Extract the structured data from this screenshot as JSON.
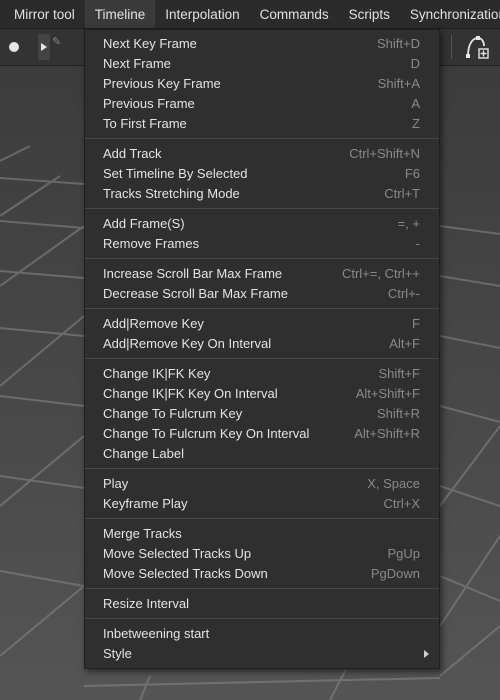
{
  "menubar": {
    "items": [
      {
        "label": "Mirror tool"
      },
      {
        "label": "Timeline"
      },
      {
        "label": "Interpolation"
      },
      {
        "label": "Commands"
      },
      {
        "label": "Scripts"
      },
      {
        "label": "Synchronization"
      }
    ],
    "active_index": 1
  },
  "menu": {
    "groups": [
      [
        {
          "label": "Next Key Frame",
          "shortcut": "Shift+D"
        },
        {
          "label": "Next Frame",
          "shortcut": "D"
        },
        {
          "label": "Previous Key Frame",
          "shortcut": "Shift+A"
        },
        {
          "label": "Previous Frame",
          "shortcut": "A"
        },
        {
          "label": "To First Frame",
          "shortcut": "Z"
        }
      ],
      [
        {
          "label": "Add Track",
          "shortcut": "Ctrl+Shift+N"
        },
        {
          "label": "Set Timeline By Selected",
          "shortcut": "F6"
        },
        {
          "label": "Tracks Stretching Mode",
          "shortcut": "Ctrl+T"
        }
      ],
      [
        {
          "label": "Add Frame(S)",
          "shortcut": "=, +"
        },
        {
          "label": "Remove Frames",
          "shortcut": "-"
        }
      ],
      [
        {
          "label": "Increase Scroll Bar Max Frame",
          "shortcut": "Ctrl+=, Ctrl++"
        },
        {
          "label": "Decrease Scroll Bar Max Frame",
          "shortcut": "Ctrl+-"
        }
      ],
      [
        {
          "label": "Add|Remove Key",
          "shortcut": "F"
        },
        {
          "label": "Add|Remove Key On Interval",
          "shortcut": "Alt+F"
        }
      ],
      [
        {
          "label": "Change IK|FK Key",
          "shortcut": "Shift+F"
        },
        {
          "label": "Change IK|FK Key On Interval",
          "shortcut": "Alt+Shift+F"
        },
        {
          "label": "Change To Fulcrum Key",
          "shortcut": "Shift+R"
        },
        {
          "label": "Change To Fulcrum Key On Interval",
          "shortcut": "Alt+Shift+R"
        },
        {
          "label": "Change Label",
          "shortcut": ""
        }
      ],
      [
        {
          "label": "Play",
          "shortcut": "X, Space"
        },
        {
          "label": "Keyframe Play",
          "shortcut": "Ctrl+X"
        }
      ],
      [
        {
          "label": "Merge Tracks",
          "shortcut": ""
        },
        {
          "label": "Move Selected Tracks Up",
          "shortcut": "PgUp"
        },
        {
          "label": "Move Selected Tracks Down",
          "shortcut": "PgDown"
        }
      ],
      [
        {
          "label": "Resize Interval",
          "shortcut": ""
        }
      ],
      [
        {
          "label": "Inbetweening start",
          "shortcut": ""
        },
        {
          "label": "Style",
          "shortcut": "",
          "submenu": true
        }
      ]
    ]
  },
  "icons": {
    "record": "record-dot-icon",
    "play": "play-icon",
    "pen": "pen-icon",
    "node": "add-node-icon"
  }
}
